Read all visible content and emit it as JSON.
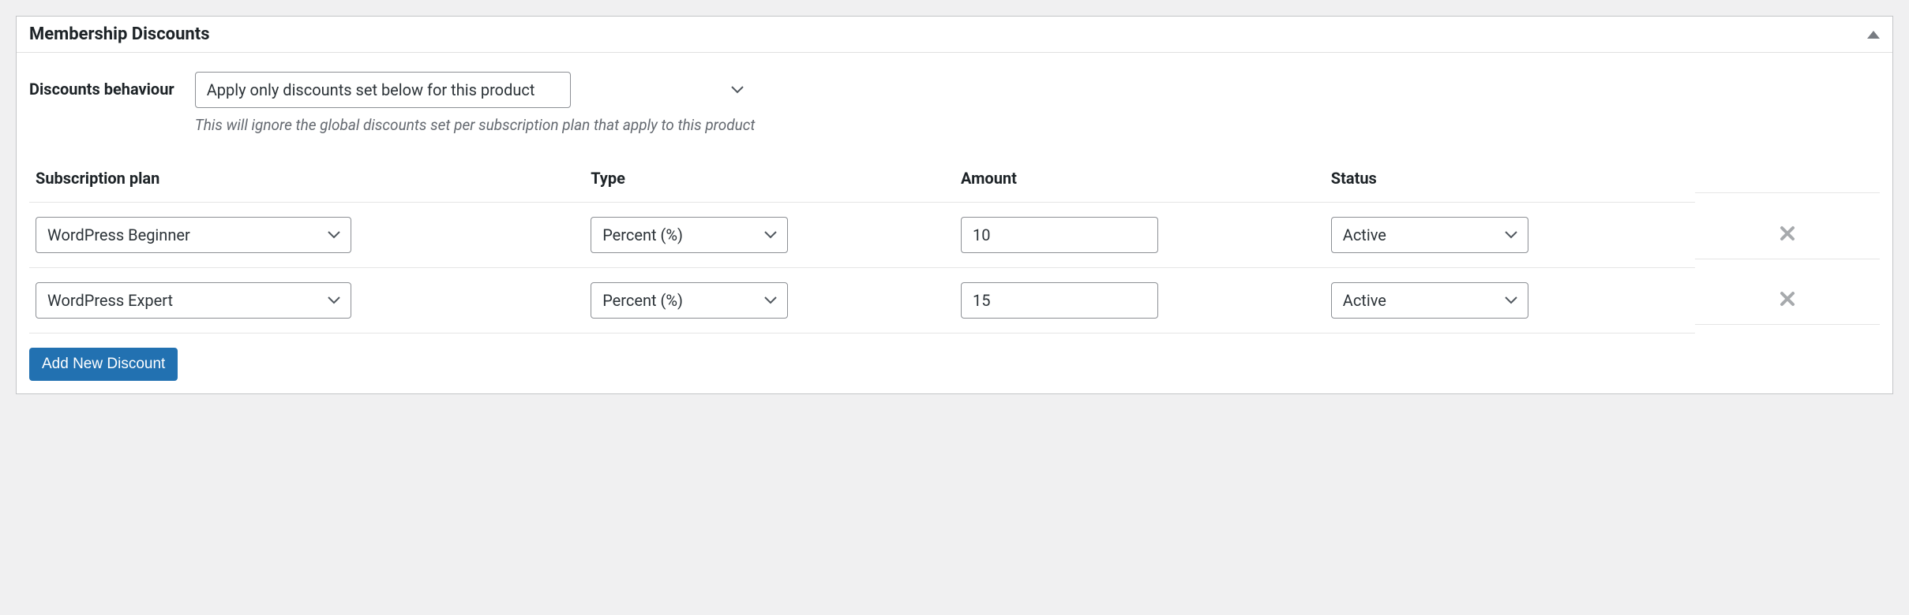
{
  "panel": {
    "title": "Membership Discounts"
  },
  "behaviour": {
    "label": "Discounts behaviour",
    "selected": "Apply only discounts set below for this product",
    "help": "This will ignore the global discounts set per subscription plan that apply to this product"
  },
  "table": {
    "headers": {
      "plan": "Subscription plan",
      "type": "Type",
      "amount": "Amount",
      "status": "Status"
    },
    "rows": [
      {
        "plan": "WordPress Beginner",
        "type": "Percent (%)",
        "amount": "10",
        "status": "Active"
      },
      {
        "plan": "WordPress Expert",
        "type": "Percent (%)",
        "amount": "15",
        "status": "Active"
      }
    ]
  },
  "buttons": {
    "add": "Add New Discount"
  }
}
